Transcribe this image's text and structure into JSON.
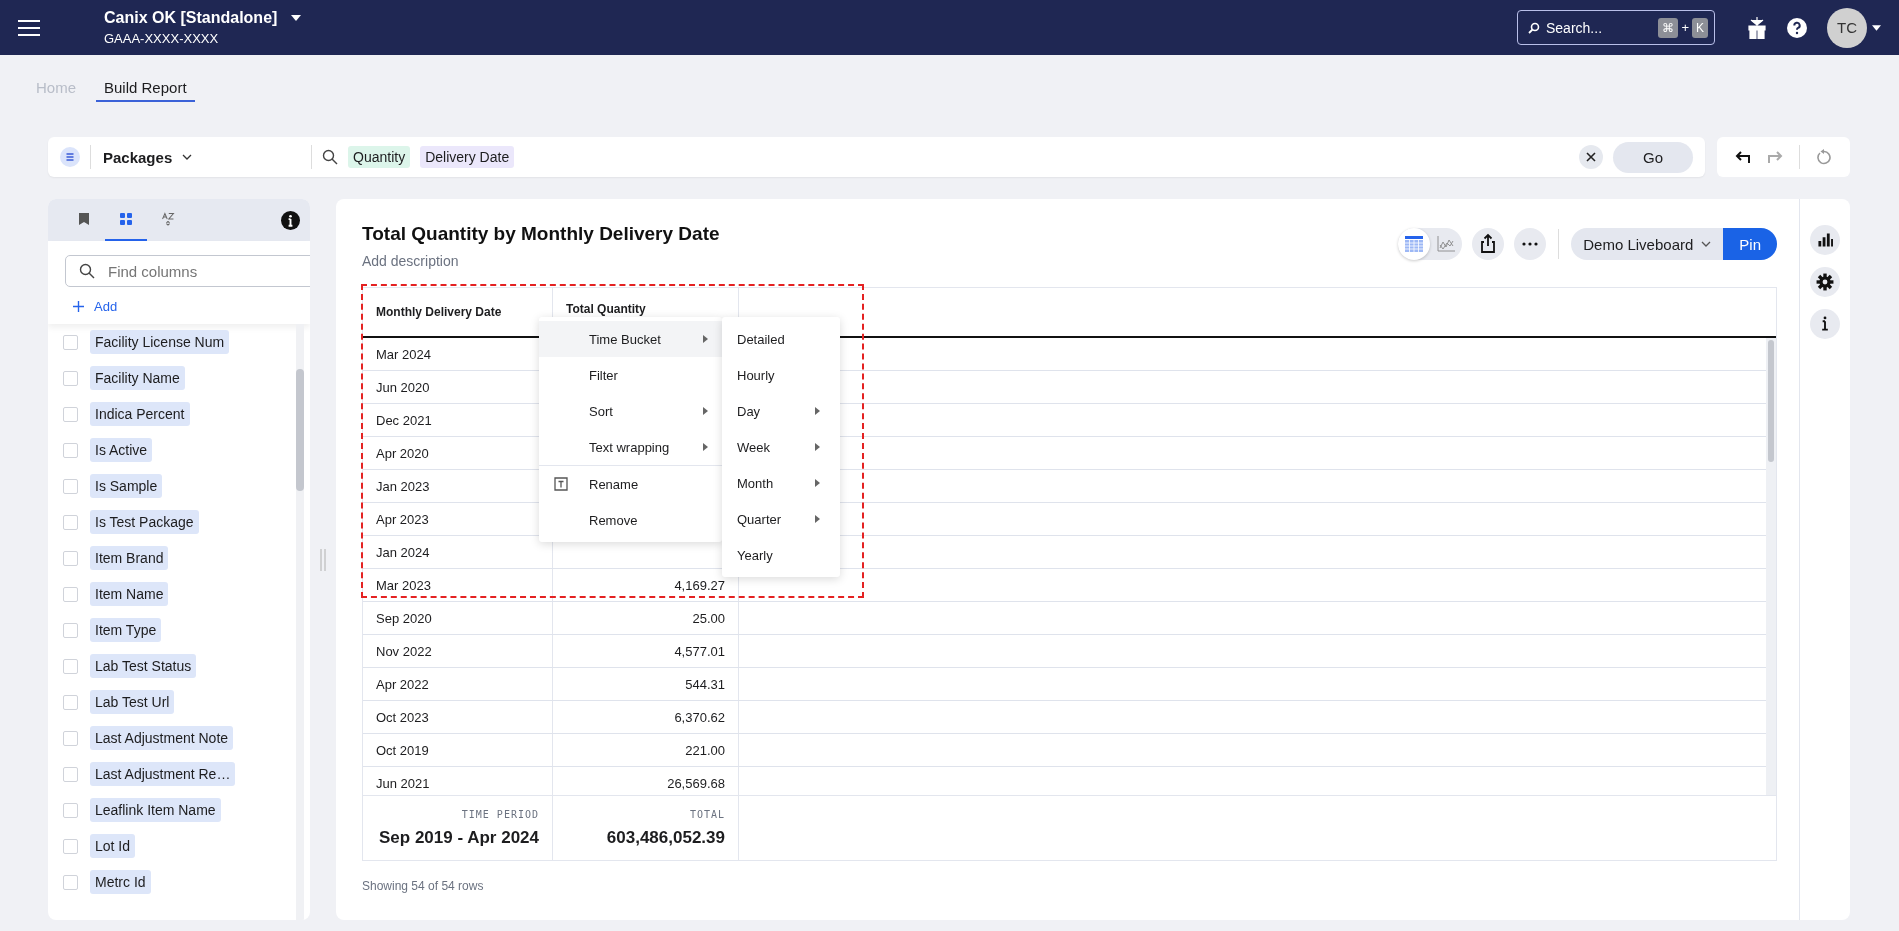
{
  "top_bar": {
    "org": "Canix OK [Standalone]",
    "org_id": "GAAA-XXXX-XXXX",
    "search": {
      "placeholder": "Search...",
      "keys": [
        "⌘",
        "+",
        "K"
      ]
    },
    "avatar": "TC"
  },
  "breadcrumb": [
    {
      "label": "Home",
      "selected": false
    },
    {
      "label": "Build Report",
      "selected": true
    }
  ],
  "search_bar": {
    "source": "Packages",
    "tokens": [
      {
        "label": "Quantity",
        "color": "#dcf5ea"
      },
      {
        "label": "Delivery Date",
        "color": "#ebe7fb"
      }
    ],
    "go": "Go"
  },
  "sidebar": {
    "tabs": [
      {
        "kind": "bookmark",
        "selected": false
      },
      {
        "kind": "grid",
        "selected": true
      },
      {
        "kind": "az",
        "selected": false
      }
    ],
    "search": {
      "placeholder": "Find columns"
    },
    "add": "Add",
    "columns": [
      {
        "label": "Facility License Num",
        "checked": false
      },
      {
        "label": "Facility Name",
        "checked": false
      },
      {
        "label": "Indica Percent",
        "checked": false
      },
      {
        "label": "Is Active",
        "checked": false
      },
      {
        "label": "Is Sample",
        "checked": false
      },
      {
        "label": "Is Test Package",
        "checked": false
      },
      {
        "label": "Item Brand",
        "checked": false
      },
      {
        "label": "Item Name",
        "checked": false
      },
      {
        "label": "Item Type",
        "checked": false
      },
      {
        "label": "Lab Test Status",
        "checked": false
      },
      {
        "label": "Lab Test Url",
        "checked": false
      },
      {
        "label": "Last Adjustment Note",
        "checked": false
      },
      {
        "label": "Last Adjustment Re…",
        "checked": false
      },
      {
        "label": "Leaflink Item Name",
        "checked": false
      },
      {
        "label": "Lot Id",
        "checked": false
      },
      {
        "label": "Metrc Id",
        "checked": false
      }
    ]
  },
  "report": {
    "title": "Total Quantity by Monthly Delivery Date",
    "description": "Add description",
    "views": [
      {
        "kind": "table",
        "selected": true
      },
      {
        "kind": "chart",
        "selected": false
      }
    ],
    "liveboard": "Demo Liveboard",
    "pin": "Pin",
    "table": {
      "columns": [
        "Monthly Delivery Date",
        "Total Quantity"
      ],
      "rows": [
        {
          "date": "Mar 2024"
        },
        {
          "date": "Jun 2020"
        },
        {
          "date": "Dec 2021"
        },
        {
          "date": "Apr 2020"
        },
        {
          "date": "Jan 2023"
        },
        {
          "date": "Apr 2023"
        },
        {
          "date": "Jan 2024"
        },
        {
          "date": "Mar 2023",
          "quantity": "4,169.27"
        },
        {
          "date": "Sep 2020",
          "quantity": "25.00"
        },
        {
          "date": "Nov 2022",
          "quantity": "4,577.01"
        },
        {
          "date": "Apr 2022",
          "quantity": "544.31"
        },
        {
          "date": "Oct 2023",
          "quantity": "6,370.62"
        },
        {
          "date": "Oct 2019",
          "quantity": "221.00"
        },
        {
          "date": "Jun 2021",
          "quantity": "26,569.68"
        }
      ],
      "footer": [
        {
          "label": "TIME PERIOD",
          "value": "Sep 2019 - Apr 2024"
        },
        {
          "label": "TOTAL",
          "value": "603,486,052.39"
        }
      ]
    },
    "status": "Showing 54 of 54 rows"
  },
  "context_menu": {
    "groups": [
      [
        {
          "label": "Time Bucket",
          "kind": "plain",
          "submenu": true,
          "selected": true
        },
        {
          "label": "Filter",
          "kind": "plain",
          "submenu": false,
          "selected": false
        },
        {
          "label": "Sort",
          "kind": "plain",
          "submenu": true,
          "selected": false
        },
        {
          "label": "Text wrapping",
          "kind": "plain",
          "submenu": true,
          "selected": false
        }
      ],
      [
        {
          "label": "Rename",
          "kind": "icon",
          "submenu": false,
          "selected": false
        },
        {
          "label": "Remove",
          "kind": "plain",
          "submenu": false,
          "selected": false
        }
      ]
    ],
    "submenu": [
      {
        "label": "Detailed",
        "submenu": false
      },
      {
        "label": "Hourly",
        "submenu": false
      },
      {
        "label": "Day",
        "submenu": true
      },
      {
        "label": "Week",
        "submenu": true
      },
      {
        "label": "Month",
        "submenu": true
      },
      {
        "label": "Quarter",
        "submenu": true
      },
      {
        "label": "Yearly",
        "submenu": false
      }
    ]
  }
}
